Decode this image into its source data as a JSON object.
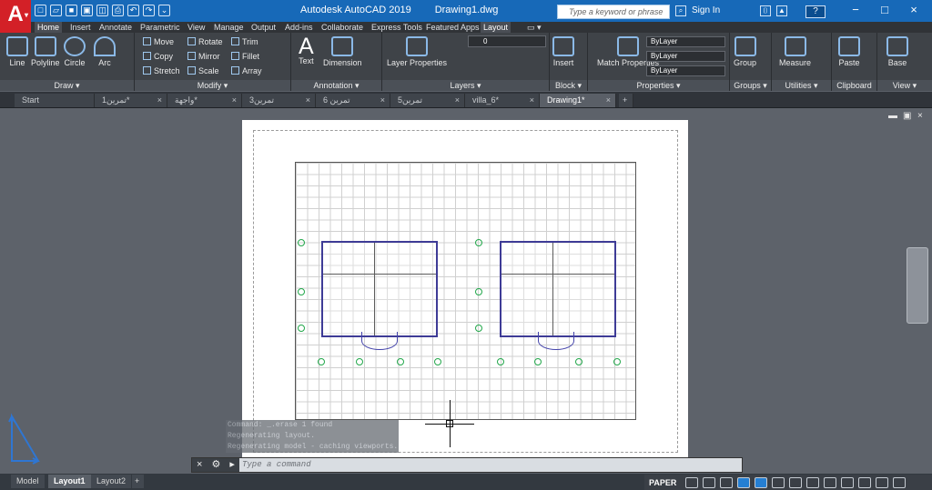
{
  "app": {
    "name": "Autodesk AutoCAD 2019",
    "file": "Drawing1.dwg",
    "logo": "A"
  },
  "search": {
    "placeholder": "Type a keyword or phrase"
  },
  "account": {
    "sign_in": "Sign In"
  },
  "ribbon_tabs": [
    "Home",
    "Insert",
    "Annotate",
    "Parametric",
    "View",
    "Manage",
    "Output",
    "Add-ins",
    "Collaborate",
    "Express Tools",
    "Featured Apps",
    "Layout"
  ],
  "ribbon": {
    "draw": {
      "label": "Draw",
      "tools": [
        "Line",
        "Polyline",
        "Circle",
        "Arc"
      ]
    },
    "modify": {
      "label": "Modify",
      "tools": [
        "Move",
        "Rotate",
        "Trim",
        "Copy",
        "Mirror",
        "Fillet",
        "Stretch",
        "Scale",
        "Array"
      ]
    },
    "annotation": {
      "label": "Annotation",
      "tools": [
        "Text",
        "Dimension"
      ]
    },
    "layers": {
      "label": "Layers",
      "layer_value": "0",
      "tool": "Layer Properties"
    },
    "block": {
      "label": "Block",
      "tool": "Insert"
    },
    "properties": {
      "label": "Properties",
      "tool": "Match Properties",
      "values": [
        "ByLayer",
        "ByLayer",
        "ByLayer"
      ]
    },
    "groups": {
      "label": "Groups",
      "tool": "Group"
    },
    "utilities": {
      "label": "Utilities",
      "tool": "Measure"
    },
    "clipboard": {
      "label": "Clipboard",
      "tool": "Paste"
    },
    "view": {
      "label": "View",
      "tool": "Base"
    }
  },
  "document_tabs": [
    "Start",
    "تمرين1*",
    "واجهة*",
    "تمرين3",
    "تمرين 6",
    "تمرين5",
    "villa_6*",
    "Drawing1*"
  ],
  "command": {
    "placeholder": "Type a command",
    "history": [
      "Command:  _.erase 1 found",
      "Regenerating layout.",
      "Regenerating model - caching viewports."
    ]
  },
  "layout_tabs": [
    "Model",
    "Layout1",
    "Layout2"
  ],
  "status": {
    "space": "PAPER"
  }
}
